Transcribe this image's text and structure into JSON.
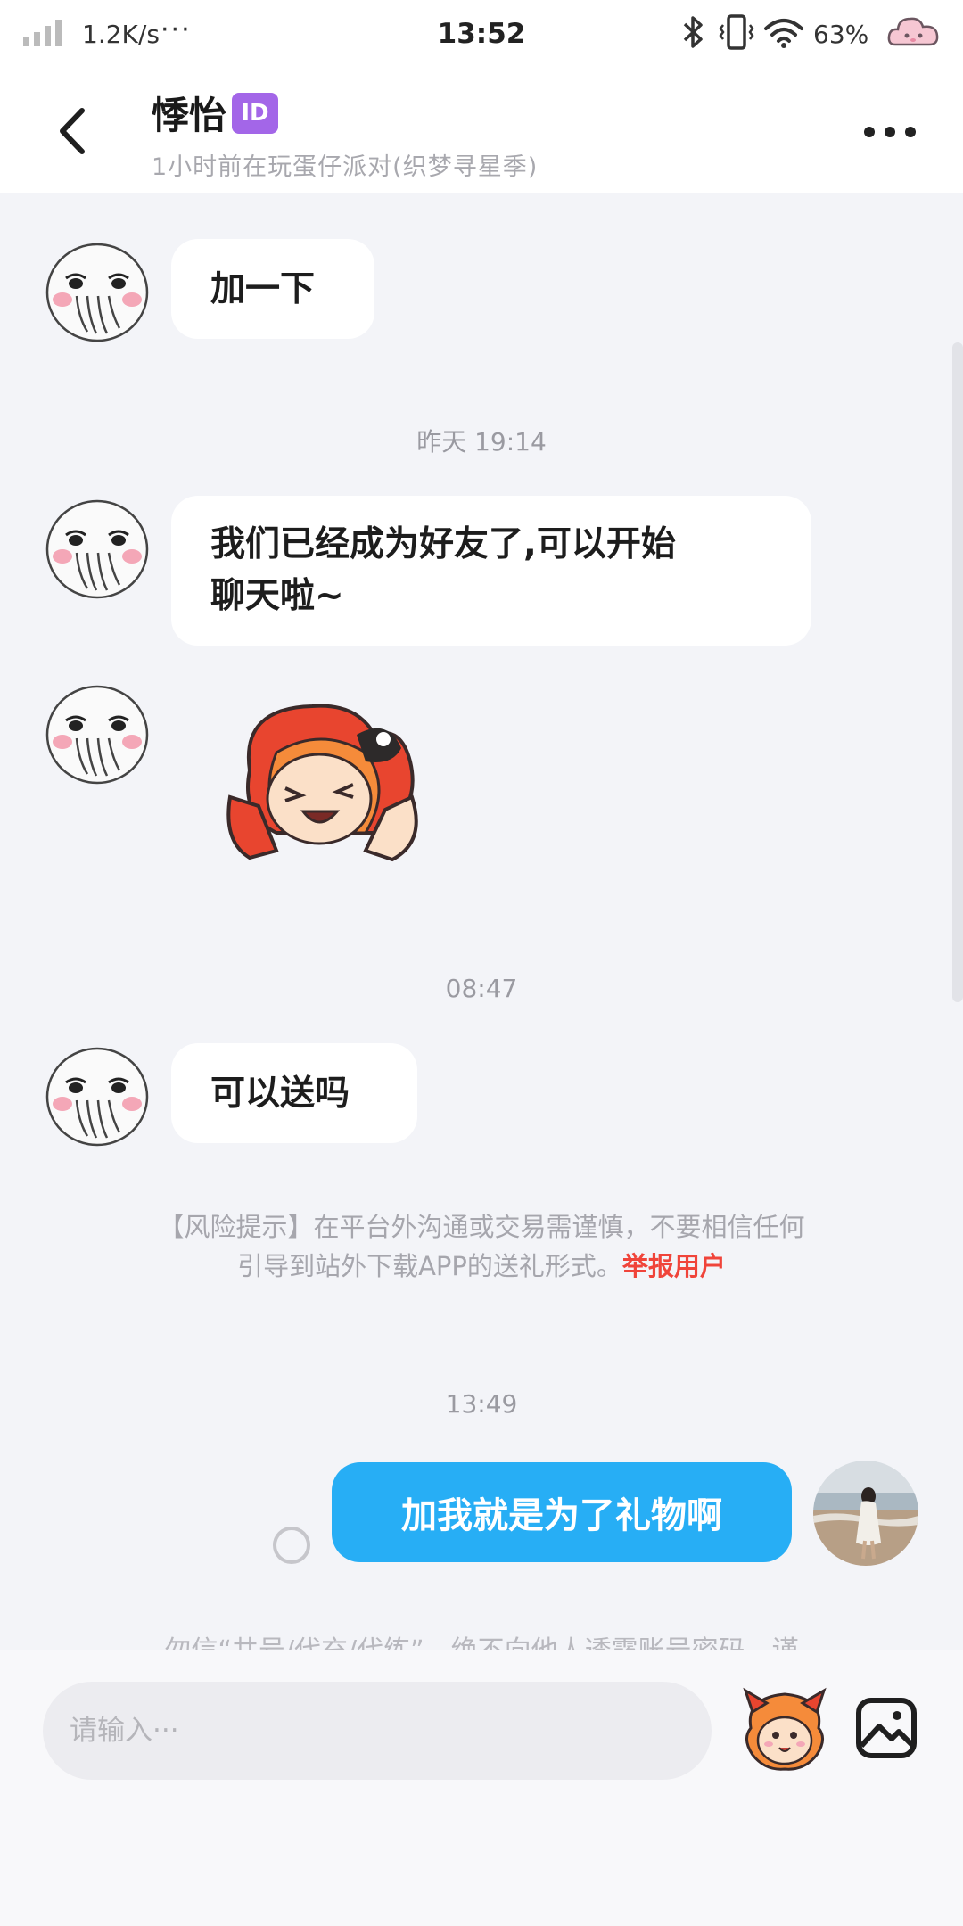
{
  "status_bar": {
    "net_speed": "1.2K/s",
    "more": "···",
    "time": "13:52",
    "battery": "63%"
  },
  "header": {
    "name": "悸怡",
    "badge": "ID",
    "status": "1小时前在玩蛋仔派对(织梦寻星季)"
  },
  "messages": {
    "msg1": "加一下",
    "time1": "昨天  19:14",
    "msg2_line1": "我们已经成为好友了,可以开始",
    "msg2_line2": "聊天啦~",
    "time2": "08:47",
    "msg3": "可以送吗",
    "risk_line1": "【风险提示】在平台外沟通或交易需谨慎，不要相信任何",
    "risk_line2": "引导到站外下载APP的送礼形式。",
    "risk_report": "举报用户",
    "time3": "13:49",
    "outgoing": "加我就是为了礼物啊",
    "partial_notice": "勿信“共号/代充/代练”，绝不向他人透露账号密码，谨"
  },
  "input": {
    "placeholder": "请输入···"
  },
  "icons": {
    "back": "back-arrow-icon",
    "more": "more-dots-icon",
    "emoji": "eggy-emoji-icon",
    "image": "image-icon"
  },
  "colors": {
    "outgoing_bubble": "#27aef5",
    "report_link": "#f0443a",
    "id_badge": "#a366e8"
  }
}
